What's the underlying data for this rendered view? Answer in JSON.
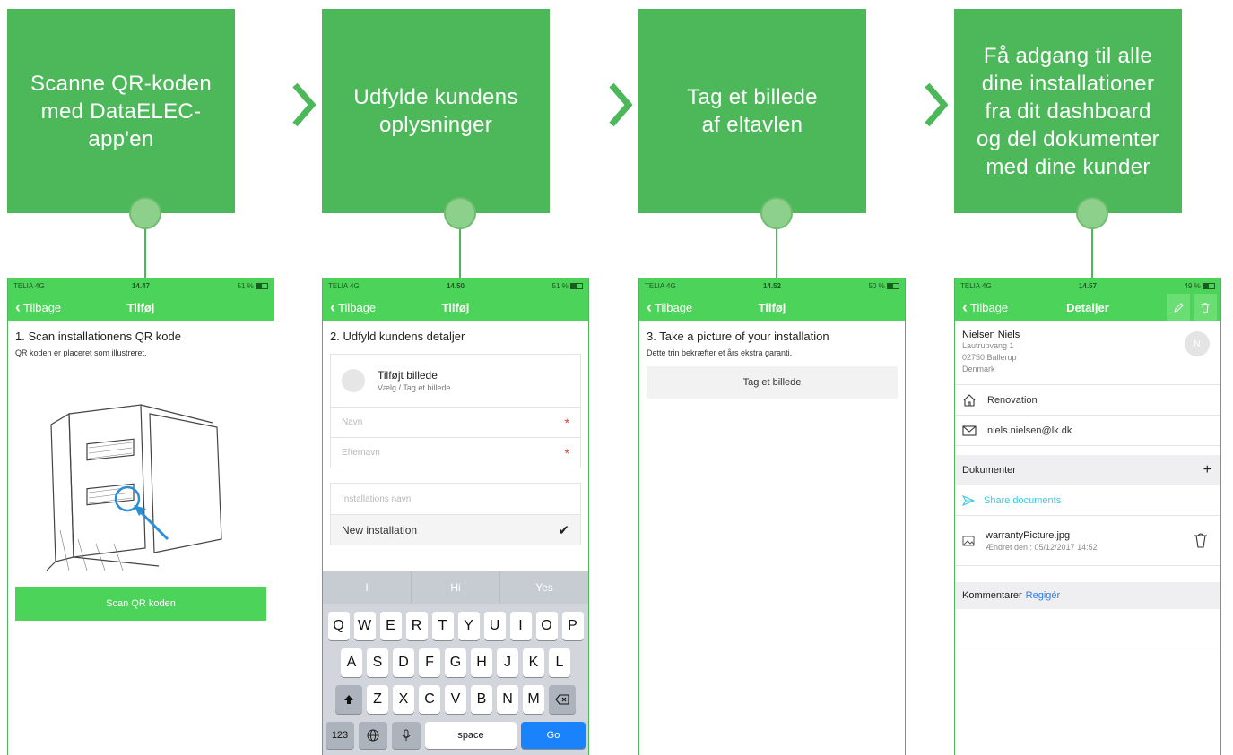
{
  "steps": [
    {
      "text": "Scanne QR-koden\nmed DataELEC-\napp'en"
    },
    {
      "text": "Udfylde kundens\noplysninger"
    },
    {
      "text": "Tag et billede\naf eltavlen"
    },
    {
      "text": "Få adgang til alle\ndine installationer\nfra dit dashboard\nog del dokumenter\nmed dine kunder"
    }
  ],
  "colors": {
    "step_green": "#4cb85a",
    "app_green": "#4cd35a",
    "link_blue": "#2a7ef5",
    "share_cyan": "#37c8e8"
  },
  "phones": [
    {
      "carrier": "TELIA  4G",
      "time": "14.47",
      "battery": "51 %",
      "back": "Tilbage",
      "title": "Tilføj",
      "heading": "1. Scan installationens QR kode",
      "subtitle": "QR koden er placeret som illustreret.",
      "button": "Scan QR koden"
    },
    {
      "carrier": "TELIA  4G",
      "time": "14.50",
      "battery": "51 %",
      "back": "Tilbage",
      "title": "Tilføj",
      "heading": "2. Udfyld kundens detaljer",
      "photo_title": "Tilføjt billede",
      "photo_sub": "Vælg / Tag et billede",
      "first_name_placeholder": "Navn",
      "last_name_placeholder": "Efternavn",
      "installation_placeholder": "Installations navn",
      "installation_value": "New installation",
      "suggestions": [
        "I",
        "Hi",
        "Yes"
      ],
      "keys_row1": [
        "Q",
        "W",
        "E",
        "R",
        "T",
        "Y",
        "U",
        "I",
        "O",
        "P"
      ],
      "keys_row2": [
        "A",
        "S",
        "D",
        "F",
        "G",
        "H",
        "J",
        "K",
        "L"
      ],
      "keys_row3": [
        "Z",
        "X",
        "C",
        "V",
        "B",
        "N",
        "M"
      ],
      "key_123": "123",
      "key_space": "space",
      "key_go": "Go"
    },
    {
      "carrier": "TELIA  4G",
      "time": "14.52",
      "battery": "50 %",
      "back": "Tilbage",
      "title": "Tilføj",
      "heading": "3. Take a picture of your installation",
      "subtitle": "Dette trin bekræfter et års ekstra garanti.",
      "button": "Tag et billede"
    },
    {
      "carrier": "TELIA  4G",
      "time": "14.57",
      "battery": "49 %",
      "back": "Tilbage",
      "title": "Detaljer",
      "contact_name": "Nielsen Niels",
      "address_1": "Lautrupvang 1",
      "address_2": "02750 Ballerup",
      "address_3": "Denmark",
      "avatar_initial": "N",
      "category": "Renovation",
      "email": "niels.nielsen@lk.dk",
      "documents_label": "Dokumenter",
      "add_symbol": "+",
      "share_label": "Share documents",
      "doc_name": "warrantyPicture.jpg",
      "doc_date": "Ændret den : 05/12/2017 14:52",
      "comments_label": "Kommentarer",
      "edit_label": "Regigér"
    }
  ]
}
